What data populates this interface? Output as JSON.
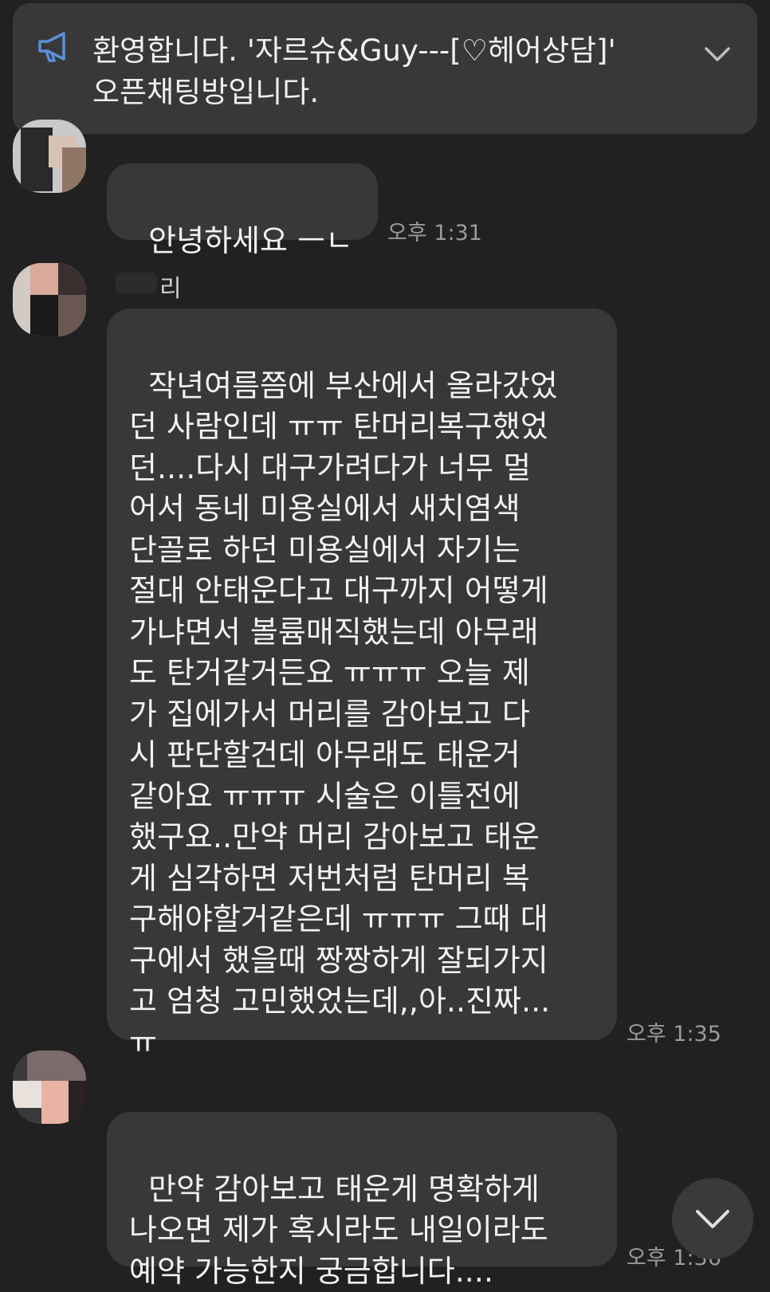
{
  "notice": {
    "icon": "megaphone-icon",
    "text": "환영합니다. '자르슈&Guy---[♡헤어상담]'\n오픈채팅방입니다.",
    "expand_icon": "chevron-down-icon"
  },
  "messages": [
    {
      "text": "안녕하세요 ㅡㄴ",
      "time": "오후 1:31"
    },
    {
      "sender_partial": "리",
      "text": "작년여름쯤에 부산에서 올라갔었\n던 사람인데 ㅠㅠ 탄머리복구했었\n던....다시 대구가려다가 너무 멀\n어서 동네 미용실에서 새치염색\n단골로 하던 미용실에서 자기는\n절대 안태운다고 대구까지 어떻게\n가냐면서 볼륨매직했는데 아무래\n도 탄거같거든요 ㅠㅠㅠ 오늘 제\n가 집에가서 머리를 감아보고 다\n시 판단할건데 아무래도 태운거\n같아요 ㅠㅠㅠ 시술은 이틀전에\n했구요..만약 머리 감아보고 태운\n게 심각하면 저번처럼 탄머리 복\n구해야할거같은데 ㅠㅠㅠ 그때 대\n구에서 했을때 짱짱하게 잘되가지\n고 엄청 고민했었는데,,아..진짜...\nㅠ",
      "time": "오후 1:35"
    },
    {
      "text": "만약 감아보고 태운게 명확하게\n나오면 제가 혹시라도 내일이라도\n예약 가능한지 궁금합니다....",
      "time": "오후 1:36"
    }
  ],
  "scroll_button_icon": "chevron-down-icon",
  "colors": {
    "background": "#212121",
    "bubble": "#383838",
    "notice": "#383838",
    "accent_icon": "#5b8fd8",
    "time_text": "#9a9a9a"
  }
}
